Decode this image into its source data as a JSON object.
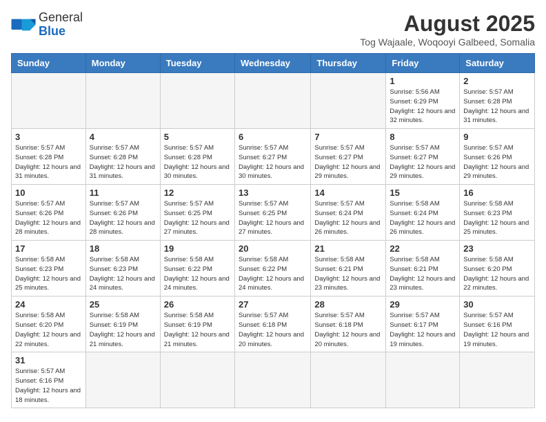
{
  "header": {
    "logo_line1": "General",
    "logo_line2": "Blue",
    "month_year": "August 2025",
    "location": "Tog Wajaale, Woqooyi Galbeed, Somalia"
  },
  "days_of_week": [
    "Sunday",
    "Monday",
    "Tuesday",
    "Wednesday",
    "Thursday",
    "Friday",
    "Saturday"
  ],
  "weeks": [
    [
      {
        "day": "",
        "info": ""
      },
      {
        "day": "",
        "info": ""
      },
      {
        "day": "",
        "info": ""
      },
      {
        "day": "",
        "info": ""
      },
      {
        "day": "",
        "info": ""
      },
      {
        "day": "1",
        "info": "Sunrise: 5:56 AM\nSunset: 6:29 PM\nDaylight: 12 hours\nand 32 minutes."
      },
      {
        "day": "2",
        "info": "Sunrise: 5:57 AM\nSunset: 6:28 PM\nDaylight: 12 hours\nand 31 minutes."
      }
    ],
    [
      {
        "day": "3",
        "info": "Sunrise: 5:57 AM\nSunset: 6:28 PM\nDaylight: 12 hours\nand 31 minutes."
      },
      {
        "day": "4",
        "info": "Sunrise: 5:57 AM\nSunset: 6:28 PM\nDaylight: 12 hours\nand 31 minutes."
      },
      {
        "day": "5",
        "info": "Sunrise: 5:57 AM\nSunset: 6:28 PM\nDaylight: 12 hours\nand 30 minutes."
      },
      {
        "day": "6",
        "info": "Sunrise: 5:57 AM\nSunset: 6:27 PM\nDaylight: 12 hours\nand 30 minutes."
      },
      {
        "day": "7",
        "info": "Sunrise: 5:57 AM\nSunset: 6:27 PM\nDaylight: 12 hours\nand 29 minutes."
      },
      {
        "day": "8",
        "info": "Sunrise: 5:57 AM\nSunset: 6:27 PM\nDaylight: 12 hours\nand 29 minutes."
      },
      {
        "day": "9",
        "info": "Sunrise: 5:57 AM\nSunset: 6:26 PM\nDaylight: 12 hours\nand 29 minutes."
      }
    ],
    [
      {
        "day": "10",
        "info": "Sunrise: 5:57 AM\nSunset: 6:26 PM\nDaylight: 12 hours\nand 28 minutes."
      },
      {
        "day": "11",
        "info": "Sunrise: 5:57 AM\nSunset: 6:26 PM\nDaylight: 12 hours\nand 28 minutes."
      },
      {
        "day": "12",
        "info": "Sunrise: 5:57 AM\nSunset: 6:25 PM\nDaylight: 12 hours\nand 27 minutes."
      },
      {
        "day": "13",
        "info": "Sunrise: 5:57 AM\nSunset: 6:25 PM\nDaylight: 12 hours\nand 27 minutes."
      },
      {
        "day": "14",
        "info": "Sunrise: 5:57 AM\nSunset: 6:24 PM\nDaylight: 12 hours\nand 26 minutes."
      },
      {
        "day": "15",
        "info": "Sunrise: 5:58 AM\nSunset: 6:24 PM\nDaylight: 12 hours\nand 26 minutes."
      },
      {
        "day": "16",
        "info": "Sunrise: 5:58 AM\nSunset: 6:23 PM\nDaylight: 12 hours\nand 25 minutes."
      }
    ],
    [
      {
        "day": "17",
        "info": "Sunrise: 5:58 AM\nSunset: 6:23 PM\nDaylight: 12 hours\nand 25 minutes."
      },
      {
        "day": "18",
        "info": "Sunrise: 5:58 AM\nSunset: 6:23 PM\nDaylight: 12 hours\nand 24 minutes."
      },
      {
        "day": "19",
        "info": "Sunrise: 5:58 AM\nSunset: 6:22 PM\nDaylight: 12 hours\nand 24 minutes."
      },
      {
        "day": "20",
        "info": "Sunrise: 5:58 AM\nSunset: 6:22 PM\nDaylight: 12 hours\nand 24 minutes."
      },
      {
        "day": "21",
        "info": "Sunrise: 5:58 AM\nSunset: 6:21 PM\nDaylight: 12 hours\nand 23 minutes."
      },
      {
        "day": "22",
        "info": "Sunrise: 5:58 AM\nSunset: 6:21 PM\nDaylight: 12 hours\nand 23 minutes."
      },
      {
        "day": "23",
        "info": "Sunrise: 5:58 AM\nSunset: 6:20 PM\nDaylight: 12 hours\nand 22 minutes."
      }
    ],
    [
      {
        "day": "24",
        "info": "Sunrise: 5:58 AM\nSunset: 6:20 PM\nDaylight: 12 hours\nand 22 minutes."
      },
      {
        "day": "25",
        "info": "Sunrise: 5:58 AM\nSunset: 6:19 PM\nDaylight: 12 hours\nand 21 minutes."
      },
      {
        "day": "26",
        "info": "Sunrise: 5:58 AM\nSunset: 6:19 PM\nDaylight: 12 hours\nand 21 minutes."
      },
      {
        "day": "27",
        "info": "Sunrise: 5:57 AM\nSunset: 6:18 PM\nDaylight: 12 hours\nand 20 minutes."
      },
      {
        "day": "28",
        "info": "Sunrise: 5:57 AM\nSunset: 6:18 PM\nDaylight: 12 hours\nand 20 minutes."
      },
      {
        "day": "29",
        "info": "Sunrise: 5:57 AM\nSunset: 6:17 PM\nDaylight: 12 hours\nand 19 minutes."
      },
      {
        "day": "30",
        "info": "Sunrise: 5:57 AM\nSunset: 6:16 PM\nDaylight: 12 hours\nand 19 minutes."
      }
    ],
    [
      {
        "day": "31",
        "info": "Sunrise: 5:57 AM\nSunset: 6:16 PM\nDaylight: 12 hours\nand 18 minutes."
      },
      {
        "day": "",
        "info": ""
      },
      {
        "day": "",
        "info": ""
      },
      {
        "day": "",
        "info": ""
      },
      {
        "day": "",
        "info": ""
      },
      {
        "day": "",
        "info": ""
      },
      {
        "day": "",
        "info": ""
      }
    ]
  ]
}
